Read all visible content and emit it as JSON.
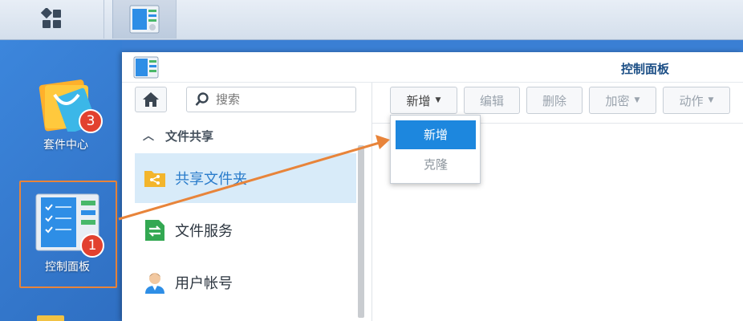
{
  "taskbar": {
    "main_icon": "grid-icon",
    "app_icon": "control-panel-icon"
  },
  "desktop": {
    "icons": [
      {
        "label": "套件中心",
        "badge": "3",
        "icon": "package-center-icon"
      },
      {
        "label": "控制面板",
        "badge": "1",
        "icon": "control-panel-icon"
      }
    ]
  },
  "window": {
    "title": "控制面板",
    "search": {
      "placeholder": "搜索",
      "value": ""
    },
    "section": "文件共享",
    "nav": [
      {
        "label": "共享文件夹",
        "icon": "shared-folder-icon",
        "active": true
      },
      {
        "label": "文件服务",
        "icon": "file-services-icon"
      },
      {
        "label": "用户帐号",
        "icon": "user-account-icon"
      }
    ],
    "toolbar": {
      "create": "新增",
      "edit": "编辑",
      "delete": "删除",
      "encrypt": "加密",
      "action": "动作"
    },
    "dropdown": {
      "items": [
        "新增",
        "克隆"
      ]
    }
  },
  "colors": {
    "accent": "#1d87de",
    "annotation": "#e8843a",
    "badge": "#e2412f"
  }
}
